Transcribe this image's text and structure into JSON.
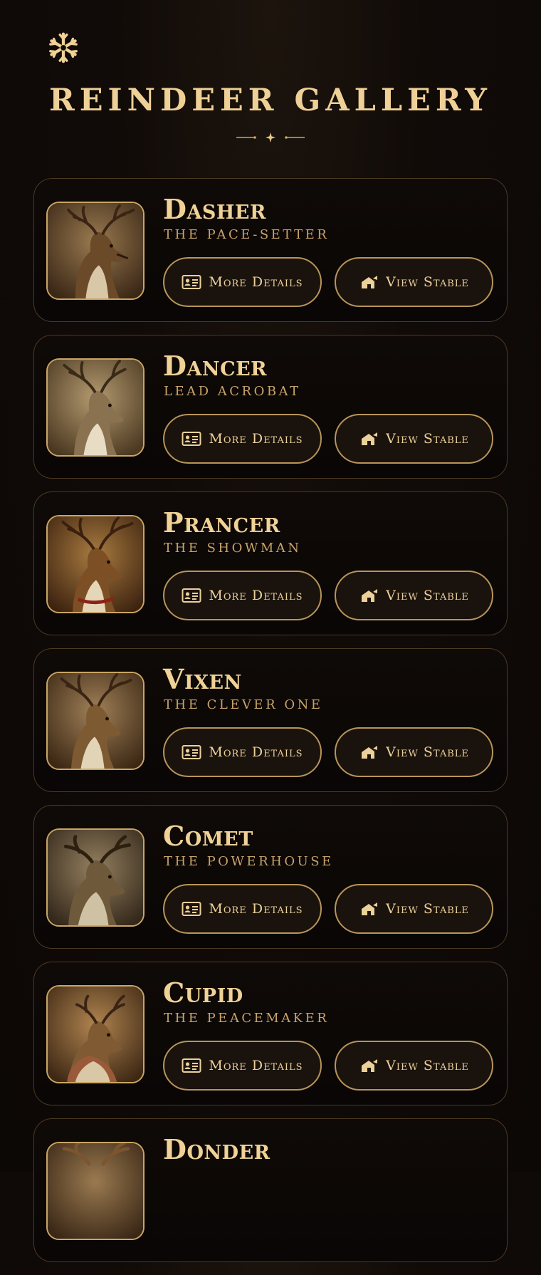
{
  "header": {
    "title": "Reindeer Gallery",
    "logo_icon": "snowflake-icon",
    "divider_icon": "star-burst-icon"
  },
  "colors": {
    "background": "#0c0806",
    "accent_gold": "#e8c98a",
    "card_border": "#4a3a22",
    "button_border": "#b8955a"
  },
  "buttons": {
    "details_label": "More Details",
    "details_icon": "id-card-icon",
    "stable_label": "View Stable",
    "stable_icon": "barn-icon"
  },
  "reindeer": [
    {
      "name": "Dasher",
      "role": "The Pace-Setter",
      "thumb_tint": "#7a5530"
    },
    {
      "name": "Dancer",
      "role": "Lead Acrobat",
      "thumb_tint": "#8a7250"
    },
    {
      "name": "Prancer",
      "role": "The Showman",
      "thumb_tint": "#7c4f25"
    },
    {
      "name": "Vixen",
      "role": "The Clever One",
      "thumb_tint": "#7d5a32"
    },
    {
      "name": "Comet",
      "role": "The Powerhouse",
      "thumb_tint": "#6e5a3a"
    },
    {
      "name": "Cupid",
      "role": "The Peacemaker",
      "thumb_tint": "#805a33"
    },
    {
      "name": "Donder",
      "role": "",
      "thumb_tint": "#7a5530"
    }
  ]
}
